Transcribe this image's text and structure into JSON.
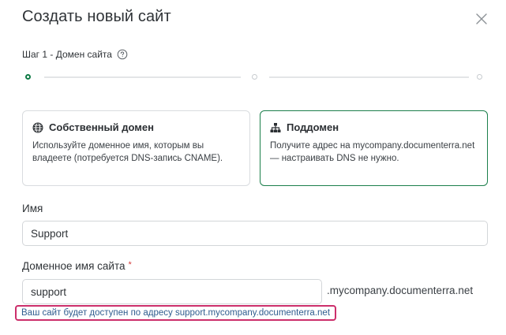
{
  "dialog": {
    "title": "Создать новый сайт"
  },
  "step": {
    "label": "Шаг 1 - Домен сайта",
    "current": 1,
    "total": 3
  },
  "domain_options": [
    {
      "title": "Собственный домен",
      "description": "Используйте доменное имя, которым вы владеете (потребуется DNS-запись CNAME).",
      "icon": "globe-icon",
      "selected": false
    },
    {
      "title": "Поддомен",
      "description": "Получите адрес на mycompany.documenterra.net — настраивать DNS не нужно.",
      "icon": "sitemap-icon",
      "selected": true
    }
  ],
  "name_field": {
    "label": "Имя",
    "value": "Support"
  },
  "domain_field": {
    "label": "Доменное имя сайта",
    "required_mark": "*",
    "value": "support",
    "suffix": ".mycompany.documenterra.net",
    "hint": "Ваш сайт будет доступен по адресу support.mycompany.documenterra.net"
  },
  "colors": {
    "accent": "#1b7f4b",
    "hint_border": "#cc2f6b",
    "hint_text": "#2f5d8f",
    "required": "#d43a3a"
  }
}
